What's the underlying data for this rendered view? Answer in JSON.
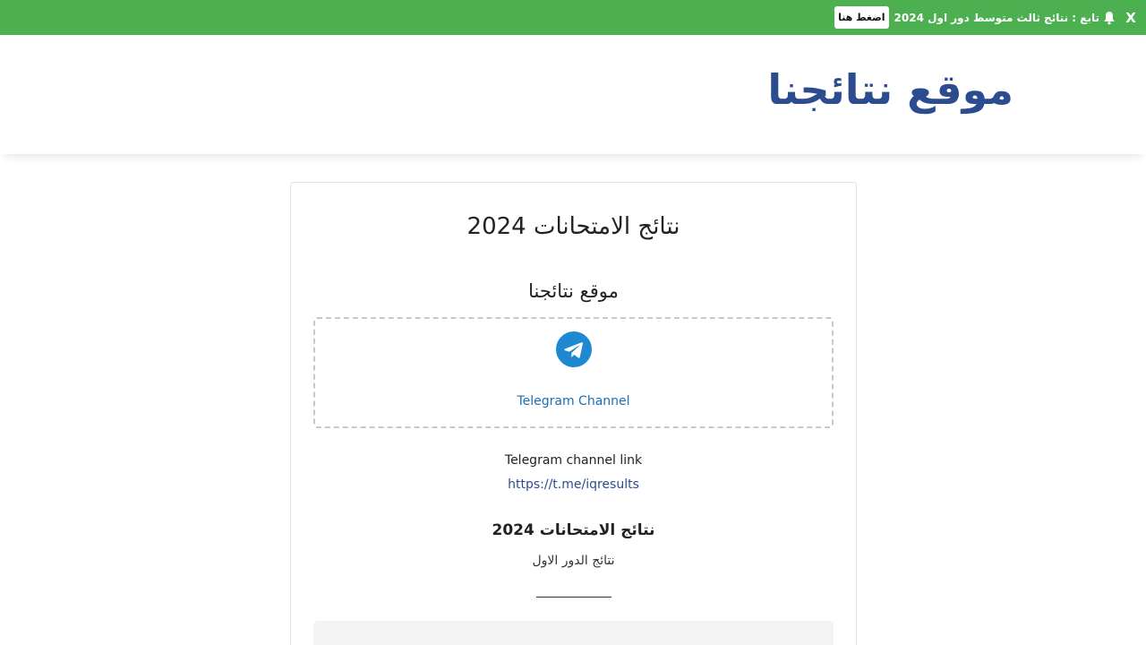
{
  "notify_bar": {
    "close_label": "X",
    "text": "تابع : نتائج ثالث متوسط دور اول 2024",
    "button_label": "اضغط هنا",
    "color": "#4caf50"
  },
  "header": {
    "site_title": "موقع نتائجنا",
    "title_color": "#2b4d8f"
  },
  "card": {
    "heading": "نتائج الامتحانات 2024",
    "subheading": "موقع نتائجنا",
    "telegram": {
      "icon": "telegram-icon",
      "label": "Telegram Channel",
      "icon_color": "#1e88d2"
    },
    "link_caption": "Telegram channel link",
    "link_url": "https://t.me/iqresults",
    "results_title": "نتائج الامتحانات 2024",
    "results_sub": "نتائج الدور الاول"
  }
}
